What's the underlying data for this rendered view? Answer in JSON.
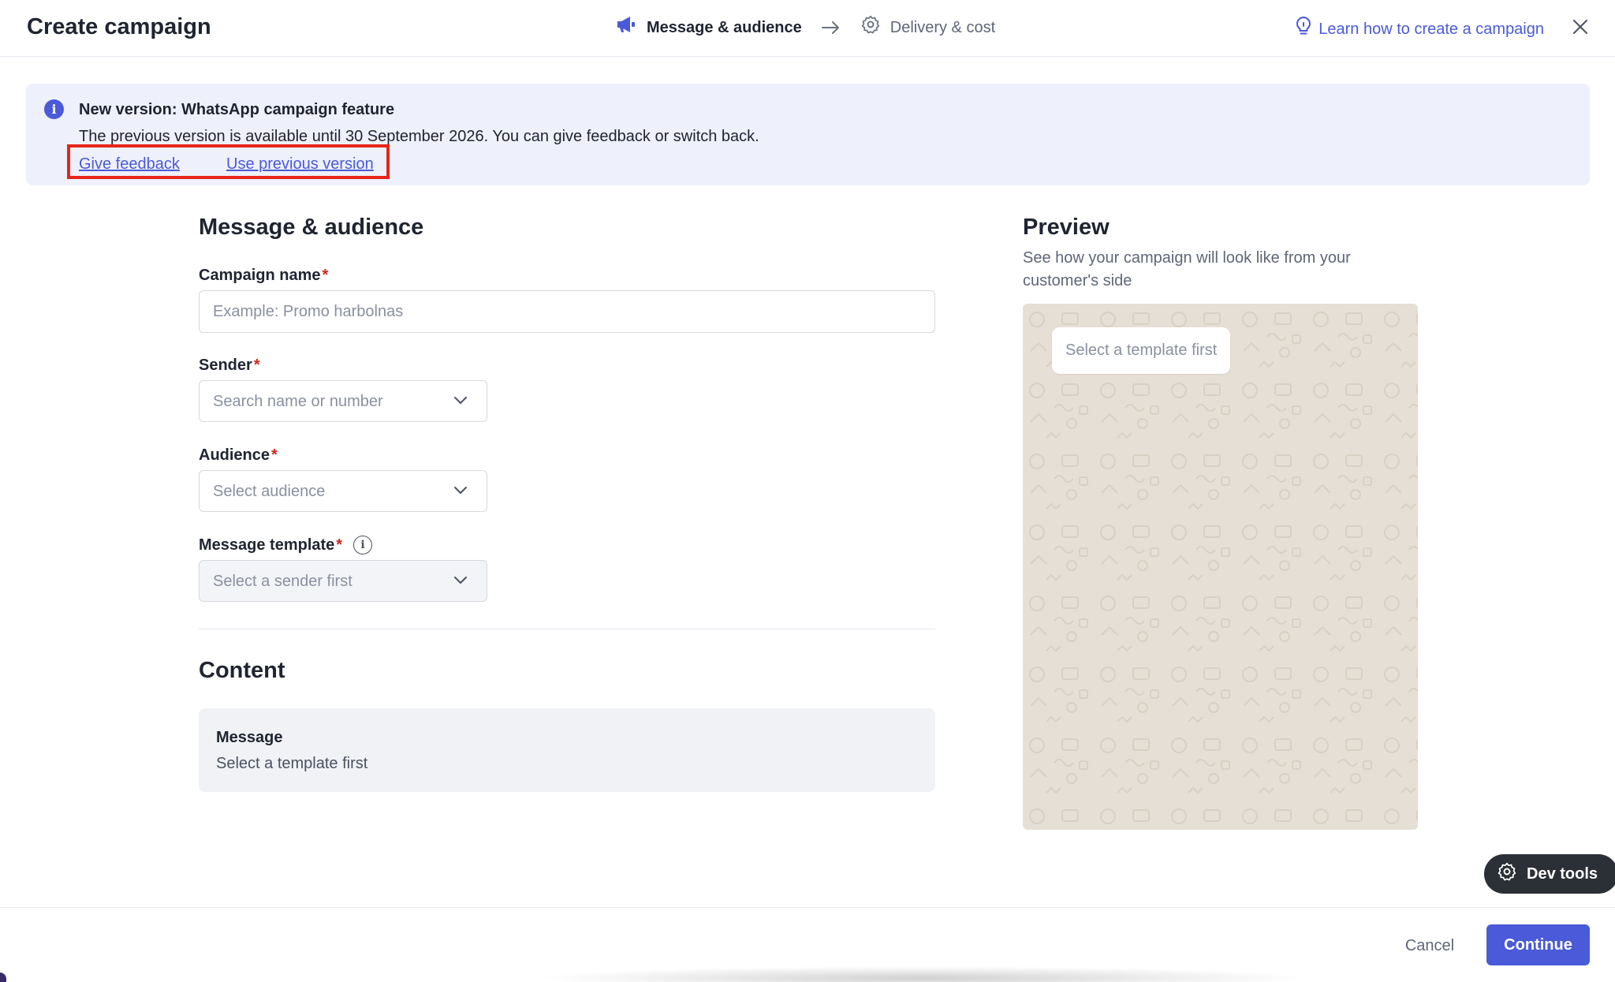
{
  "header": {
    "title": "Create campaign",
    "steps": [
      {
        "label": "Message & audience",
        "icon": "megaphone-icon",
        "state": "active"
      },
      {
        "label": "Delivery & cost",
        "icon": "gear-icon",
        "state": "inactive"
      }
    ],
    "learn_link": "Learn how to create a campaign"
  },
  "banner": {
    "title": "New version: WhatsApp campaign feature",
    "text": "The previous version is available until 30 September 2026. You can give feedback or switch back.",
    "feedback_link": "Give feedback",
    "previous_link": "Use previous version"
  },
  "form": {
    "section_title": "Message & audience",
    "campaign_name": {
      "label": "Campaign name",
      "required": "*",
      "placeholder": "Example: Promo harbolnas",
      "value": ""
    },
    "sender": {
      "label": "Sender",
      "required": "*",
      "placeholder": "Search name or number"
    },
    "audience": {
      "label": "Audience",
      "required": "*",
      "placeholder": "Select audience"
    },
    "template": {
      "label": "Message template",
      "required": "*",
      "placeholder": "Select a sender first"
    }
  },
  "content": {
    "section_title": "Content",
    "message_title": "Message",
    "message_text": "Select a template first"
  },
  "preview": {
    "title": "Preview",
    "description": "See how your campaign will look like from your customer's side",
    "bubble_text": "Select a template first"
  },
  "dev_tools": {
    "label": "Dev tools"
  },
  "footer": {
    "cancel": "Cancel",
    "continue": "Continue"
  },
  "colors": {
    "accent": "#4a5ad8",
    "highlight_border": "#e8251a",
    "banner_bg": "#eef0fb",
    "preview_bg": "#e6dfd5",
    "required": "#d0251c"
  }
}
